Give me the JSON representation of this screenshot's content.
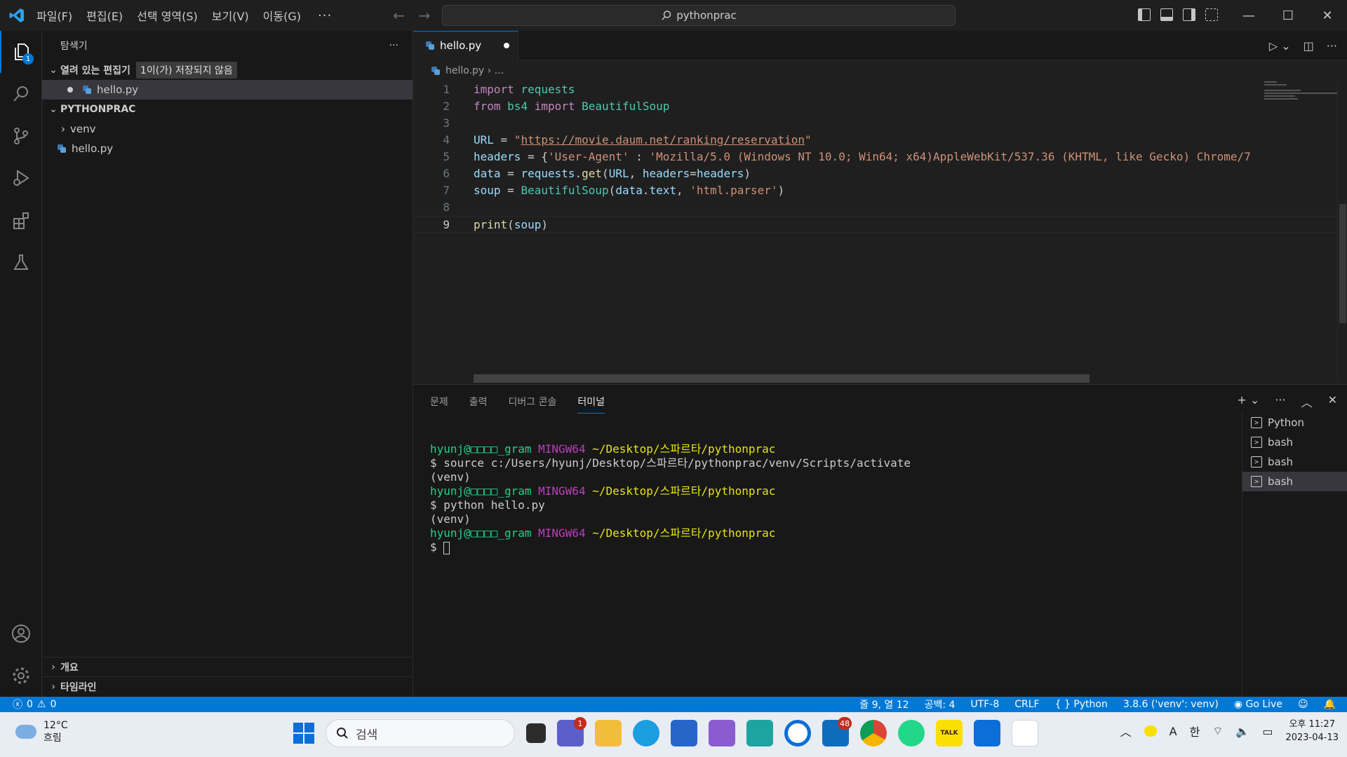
{
  "titlebar": {
    "menus": [
      "파일(F)",
      "편집(E)",
      "선택 영역(S)",
      "보기(V)",
      "이동(G)"
    ],
    "more": "···",
    "search": "pythonprac",
    "controls": {
      "min": "—",
      "max": "☐",
      "close": "✕"
    }
  },
  "activity": {
    "explorer_badge": "1"
  },
  "sidebar": {
    "title": "탐색기",
    "more": "···",
    "open_editors": {
      "label": "열려 있는 편집기",
      "badge": "1이(가) 저장되지 않음",
      "files": [
        "hello.py"
      ]
    },
    "project": {
      "label": "PYTHONPRAC",
      "items": [
        {
          "name": "venv",
          "type": "folder"
        },
        {
          "name": "hello.py",
          "type": "file"
        }
      ]
    },
    "outline": "개요",
    "timeline": "타임라인"
  },
  "editor": {
    "tab": "hello.py",
    "breadcrumb": [
      "hello.py",
      "..."
    ],
    "lines": [
      "import requests",
      "from bs4 import BeautifulSoup",
      "",
      "URL = \"https://movie.daum.net/ranking/reservation\"",
      "headers = {'User-Agent' : 'Mozilla/5.0 (Windows NT 10.0; Win64; x64)AppleWebKit/537.36 (KHTML, like Gecko) Chrome/7",
      "data = requests.get(URL, headers=headers)",
      "soup = BeautifulSoup(data.text, 'html.parser')",
      "",
      "print(soup)"
    ],
    "current_line": 9
  },
  "panel": {
    "tabs": [
      "문제",
      "출력",
      "디버그 콘솔",
      "터미널"
    ],
    "active_tab": "터미널",
    "terminal": {
      "user": "hyunj@□□□□_gram",
      "host": "MINGW64",
      "path": "~/Desktop/스파르타/pythonprac",
      "cmd1": "$ source c:/Users/hyunj/Desktop/스파르타/pythonprac/venv/Scripts/activate",
      "venv": "(venv)",
      "cmd2": "$ python hello.py",
      "prompt": "$ "
    },
    "terminals": [
      "Python",
      "bash",
      "bash",
      "bash"
    ]
  },
  "status": {
    "errors": "0",
    "warnings": "0",
    "position": "줄 9, 열 12",
    "spaces": "공백: 4",
    "encoding": "UTF-8",
    "eol": "CRLF",
    "language": "Python",
    "interpreter": "3.8.6 ('venv': venv)",
    "golive": "Go Live"
  },
  "taskbar": {
    "temp": "12°C",
    "weather": "흐림",
    "search": "검색",
    "teams_badge": "1",
    "mail_badge": "48",
    "ime": "한",
    "time": "오후 11:27",
    "date": "2023-04-13"
  },
  "colors": {
    "accent": "#0078d4",
    "statusbar": "#0078d4"
  }
}
